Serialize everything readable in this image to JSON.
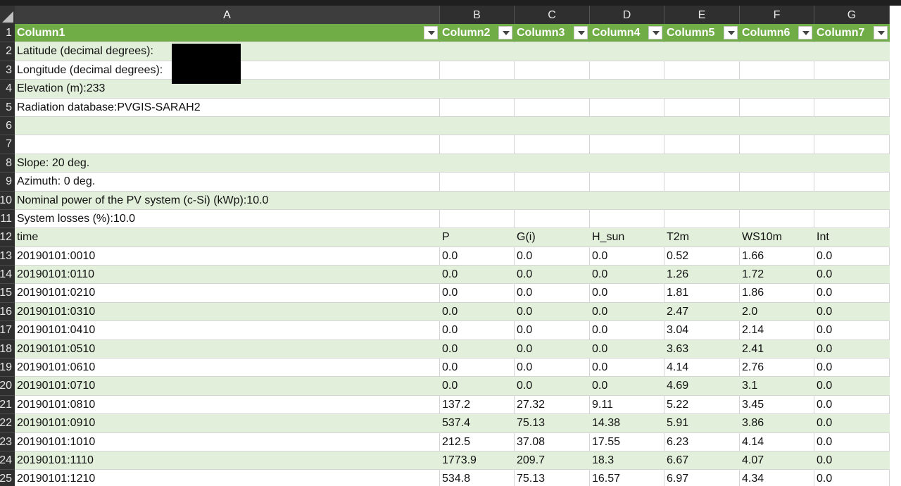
{
  "columns": [
    "A",
    "B",
    "C",
    "D",
    "E",
    "F",
    "G"
  ],
  "header": {
    "row_num": "1",
    "labels": [
      "Column1",
      "Column2",
      "Column3",
      "Column4",
      "Column5",
      "Column6",
      "Column7"
    ]
  },
  "meta_rows": [
    {
      "num": "2",
      "text": "Latitude (decimal degrees):"
    },
    {
      "num": "3",
      "text": "Longitude (decimal degrees):"
    },
    {
      "num": "4",
      "text": "Elevation (m):233"
    },
    {
      "num": "5",
      "text": "Radiation database:PVGIS-SARAH2"
    },
    {
      "num": "6",
      "text": ""
    },
    {
      "num": "7",
      "text": ""
    },
    {
      "num": "8",
      "text": "Slope: 20 deg."
    },
    {
      "num": "9",
      "text": "Azimuth: 0 deg."
    },
    {
      "num": "10",
      "text": "Nominal power of the PV system (c-Si) (kWp):10.0"
    },
    {
      "num": "11",
      "text": "System losses (%):10.0"
    }
  ],
  "table_header_row": {
    "num": "12",
    "cells": [
      "time",
      "P",
      "G(i)",
      "H_sun",
      "T2m",
      "WS10m",
      "Int"
    ]
  },
  "data_rows": [
    {
      "num": "13",
      "cells": [
        "20190101:0010",
        "0.0",
        "0.0",
        "0.0",
        "0.52",
        "1.66",
        "0.0"
      ]
    },
    {
      "num": "14",
      "cells": [
        "20190101:0110",
        "0.0",
        "0.0",
        "0.0",
        "1.26",
        "1.72",
        "0.0"
      ]
    },
    {
      "num": "15",
      "cells": [
        "20190101:0210",
        "0.0",
        "0.0",
        "0.0",
        "1.81",
        "1.86",
        "0.0"
      ]
    },
    {
      "num": "16",
      "cells": [
        "20190101:0310",
        "0.0",
        "0.0",
        "0.0",
        "2.47",
        "2.0",
        "0.0"
      ]
    },
    {
      "num": "17",
      "cells": [
        "20190101:0410",
        "0.0",
        "0.0",
        "0.0",
        "3.04",
        "2.14",
        "0.0"
      ]
    },
    {
      "num": "18",
      "cells": [
        "20190101:0510",
        "0.0",
        "0.0",
        "0.0",
        "3.63",
        "2.41",
        "0.0"
      ]
    },
    {
      "num": "19",
      "cells": [
        "20190101:0610",
        "0.0",
        "0.0",
        "0.0",
        "4.14",
        "2.76",
        "0.0"
      ]
    },
    {
      "num": "20",
      "cells": [
        "20190101:0710",
        "0.0",
        "0.0",
        "0.0",
        "4.69",
        "3.1",
        "0.0"
      ]
    },
    {
      "num": "21",
      "cells": [
        "20190101:0810",
        "137.2",
        "27.32",
        "9.11",
        "5.22",
        "3.45",
        "0.0"
      ]
    },
    {
      "num": "22",
      "cells": [
        "20190101:0910",
        "537.4",
        "75.13",
        "14.38",
        "5.91",
        "3.86",
        "0.0"
      ]
    },
    {
      "num": "23",
      "cells": [
        "20190101:1010",
        "212.5",
        "37.08",
        "17.55",
        "6.23",
        "4.14",
        "0.0"
      ]
    },
    {
      "num": "24",
      "cells": [
        "20190101:1110",
        "1773.9",
        "209.7",
        "18.3",
        "6.67",
        "4.07",
        "0.0"
      ]
    },
    {
      "num": "25",
      "cells": [
        "20190101:1210",
        "534.8",
        "75.13",
        "16.57",
        "6.97",
        "4.34",
        "0.0"
      ]
    }
  ],
  "colors": {
    "header_green": "#70ad47",
    "band_green": "#e2efda",
    "row_header_bg": "#2f2f2f"
  }
}
